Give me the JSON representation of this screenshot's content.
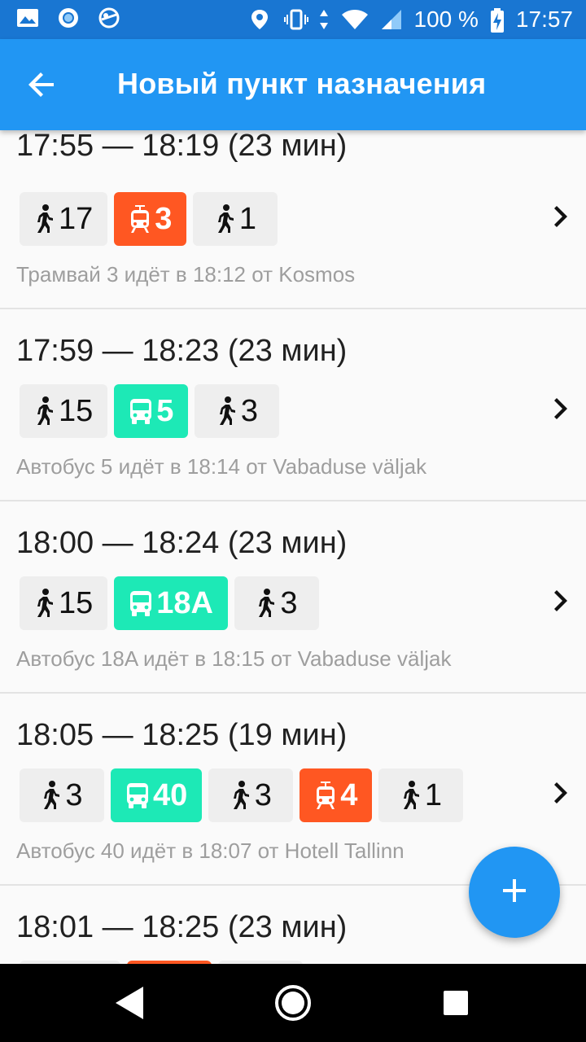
{
  "status_bar": {
    "battery": "100 %",
    "time": "17:57",
    "icons": [
      "image-icon",
      "record-icon",
      "vpn-icon",
      "location-icon",
      "vibrate-icon",
      "data-transfer-icon",
      "wifi-icon",
      "signal-icon",
      "battery-charging-icon"
    ]
  },
  "app_bar": {
    "title": "Новый пункт назначения",
    "back_icon": "arrow-back-icon"
  },
  "routes": [
    {
      "time": "17:55 — 18:19 (23 мин)",
      "legs": [
        {
          "type": "walk",
          "label": "17"
        },
        {
          "type": "tram",
          "label": "3"
        },
        {
          "type": "walk",
          "label": "1"
        }
      ],
      "info": "Трамвай 3 идёт в 18:12 от Kosmos"
    },
    {
      "time": "17:59 — 18:23 (23 мин)",
      "legs": [
        {
          "type": "walk",
          "label": "15"
        },
        {
          "type": "bus",
          "label": "5"
        },
        {
          "type": "walk",
          "label": "3"
        }
      ],
      "info": "Автобус 5 идёт в 18:14 от Vabaduse väljak"
    },
    {
      "time": "18:00 — 18:24 (23 мин)",
      "legs": [
        {
          "type": "walk",
          "label": "15"
        },
        {
          "type": "bus",
          "label": "18A"
        },
        {
          "type": "walk",
          "label": "3"
        }
      ],
      "info": "Автобус 18A идёт в 18:15 от Vabaduse väljak"
    },
    {
      "time": "18:05 — 18:25 (19 мин)",
      "legs": [
        {
          "type": "walk",
          "label": "3"
        },
        {
          "type": "bus",
          "label": "40"
        },
        {
          "type": "walk",
          "label": "3"
        },
        {
          "type": "tram",
          "label": "4"
        },
        {
          "type": "walk",
          "label": "1"
        }
      ],
      "info": "Автобус 40 идёт в 18:07 от Hotell Tallinn"
    },
    {
      "time": "18:01 — 18:25 (23 мин)",
      "legs": [
        {
          "type": "walk",
          "label": ""
        },
        {
          "type": "tram",
          "label": ""
        },
        {
          "type": "walk",
          "label": ""
        }
      ],
      "info": ""
    }
  ],
  "fab": {
    "icon": "plus-icon"
  },
  "nav_bar": {
    "icons": [
      "back-triangle-icon",
      "home-circle-icon",
      "recents-square-icon"
    ]
  },
  "colors": {
    "status_bar": "#1976d2",
    "app_bar": "#2196f3",
    "tram": "#ff5722",
    "bus": "#1de9b6",
    "walk_bg": "#eeeeee"
  }
}
